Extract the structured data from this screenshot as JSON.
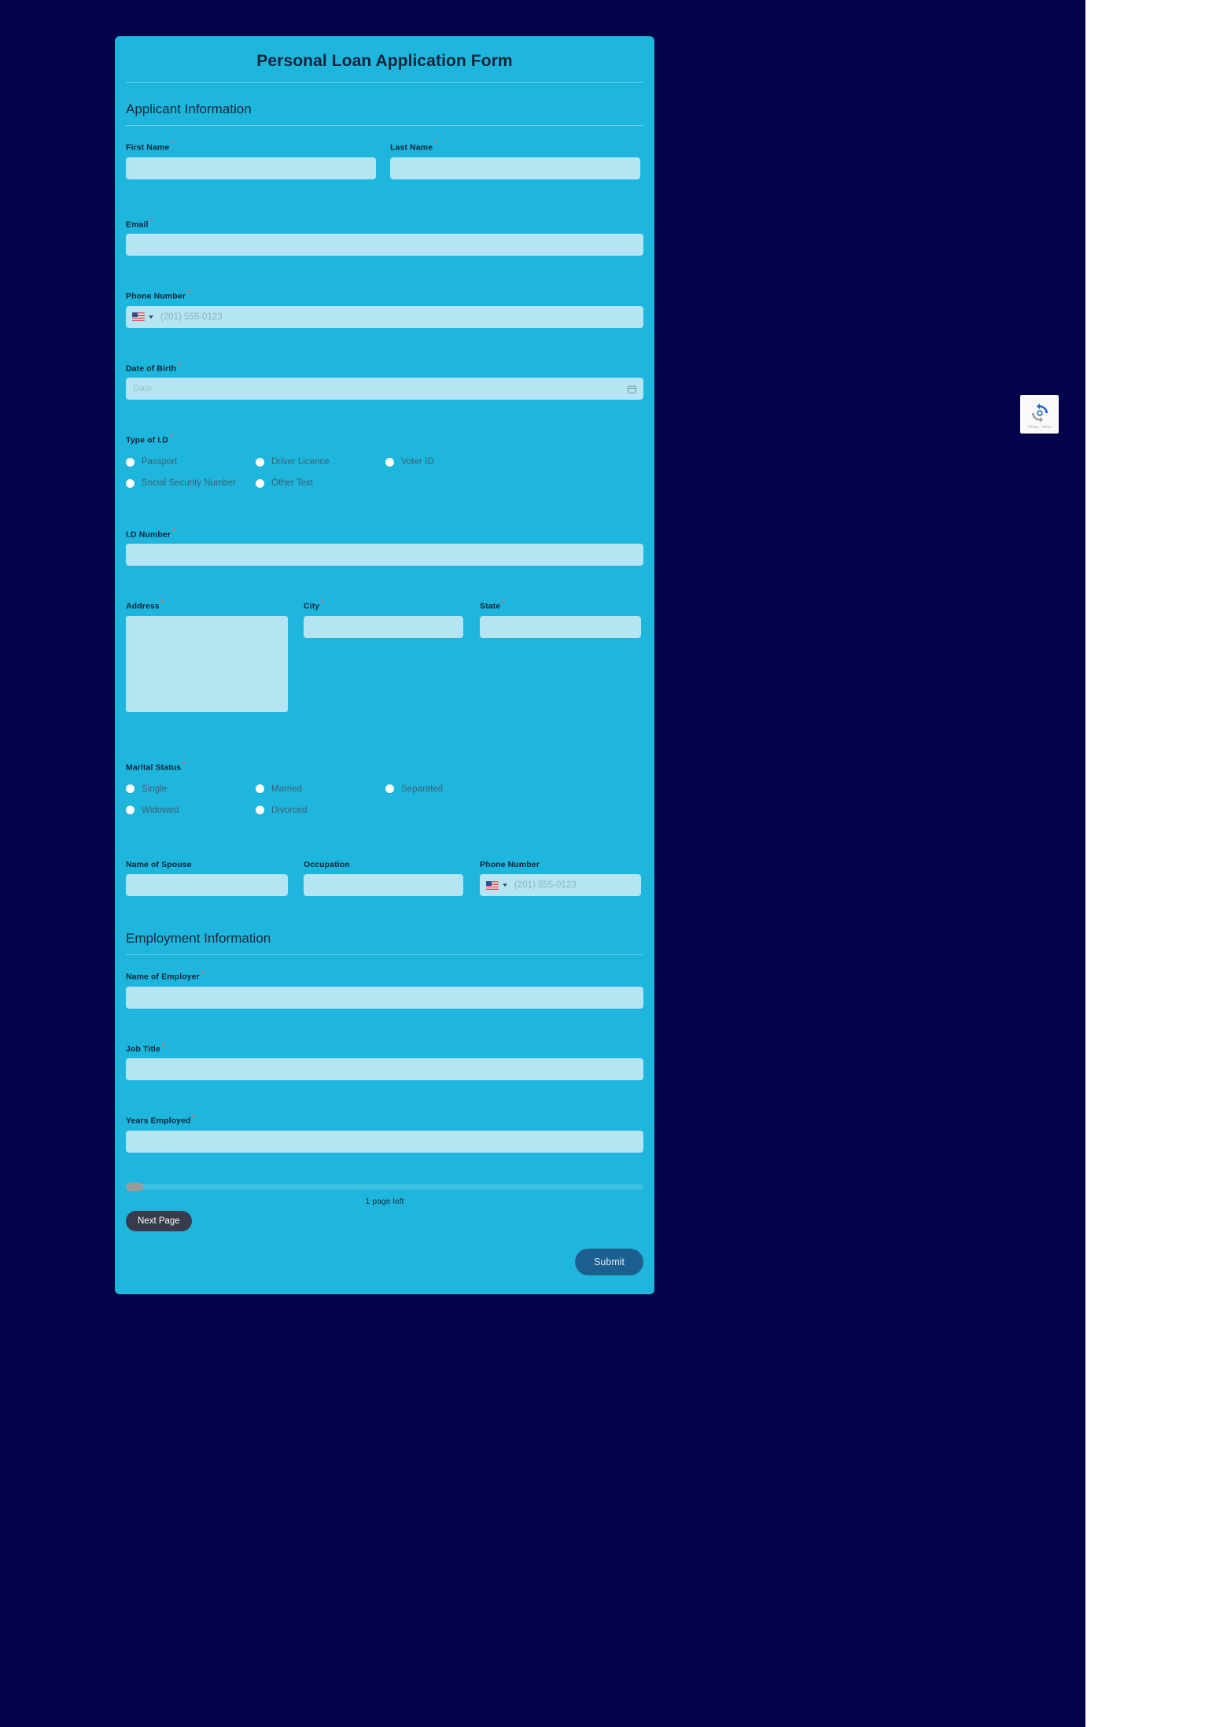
{
  "form": {
    "title": "Personal Loan Application Form",
    "sections": [
      {
        "heading": "Applicant Information"
      },
      {
        "heading": "Employment Information"
      }
    ],
    "fields": {
      "first_name": {
        "label": "First Name",
        "required_mark": "*",
        "value": ""
      },
      "last_name": {
        "label": "Last Name",
        "required_mark": "*",
        "value": ""
      },
      "email": {
        "label": "Email",
        "required_mark": "*",
        "value": ""
      },
      "phone_number": {
        "label": "Phone Number",
        "required_mark": "*",
        "value": "",
        "placeholder": "(201) 555-0123",
        "country_flag": "us-flag-icon"
      },
      "date_of_birth": {
        "label": "Date of Birth",
        "required_mark": "*",
        "value": "",
        "placeholder": "Date",
        "icon": "calendar-icon"
      },
      "type_of_id": {
        "label": "Type of I.D",
        "required_mark": "*",
        "options": [
          "Passport",
          "Driver Licence",
          "Voter ID",
          "Social Security Number",
          "Other Text"
        ],
        "selected": ""
      },
      "id_number": {
        "label": "I.D Number",
        "required_mark": "*",
        "value": ""
      },
      "address": {
        "label": "Address",
        "required_mark": "*",
        "value": ""
      },
      "city": {
        "label": "City",
        "required_mark": "*",
        "value": ""
      },
      "state": {
        "label": "State",
        "required_mark": "*",
        "value": ""
      },
      "marital_status": {
        "label": "Marital Status",
        "required_mark": "*",
        "options": [
          "Single",
          "Married",
          "Separated",
          "Widowed",
          "Divorced"
        ],
        "selected": ""
      },
      "name_of_spouse": {
        "label": "Name of Spouse",
        "required_mark": "",
        "value": ""
      },
      "occupation": {
        "label": "Occupation",
        "required_mark": "",
        "value": ""
      },
      "spouse_phone_number": {
        "label": "Phone Number",
        "required_mark": "",
        "value": "",
        "placeholder": "(201) 555-0123",
        "country_flag": "us-flag-icon"
      },
      "name_of_employer": {
        "label": "Name of Employer",
        "required_mark": "*",
        "value": ""
      },
      "job_title": {
        "label": "Job Title",
        "required_mark": "*",
        "value": ""
      },
      "years_employed": {
        "label": "Years Employed",
        "required_mark": "*",
        "value": ""
      }
    },
    "footer": {
      "pages_left": "1 page left",
      "progress_percent": 3,
      "next_page_label": "Next Page",
      "submit_label": "Submit"
    }
  },
  "recaptcha": {
    "links": "Privacy - Terms",
    "icon": "recaptcha-icon"
  },
  "colors": {
    "page_background": "#04024a",
    "card_background": "#1fb6dd",
    "input_background": "#b5e4f2",
    "submit_button": "#1d5f8f",
    "next_page_button": "#3a3a4d",
    "required_asterisk": "#f2604f",
    "progress_handle": "#9a9a9a"
  }
}
